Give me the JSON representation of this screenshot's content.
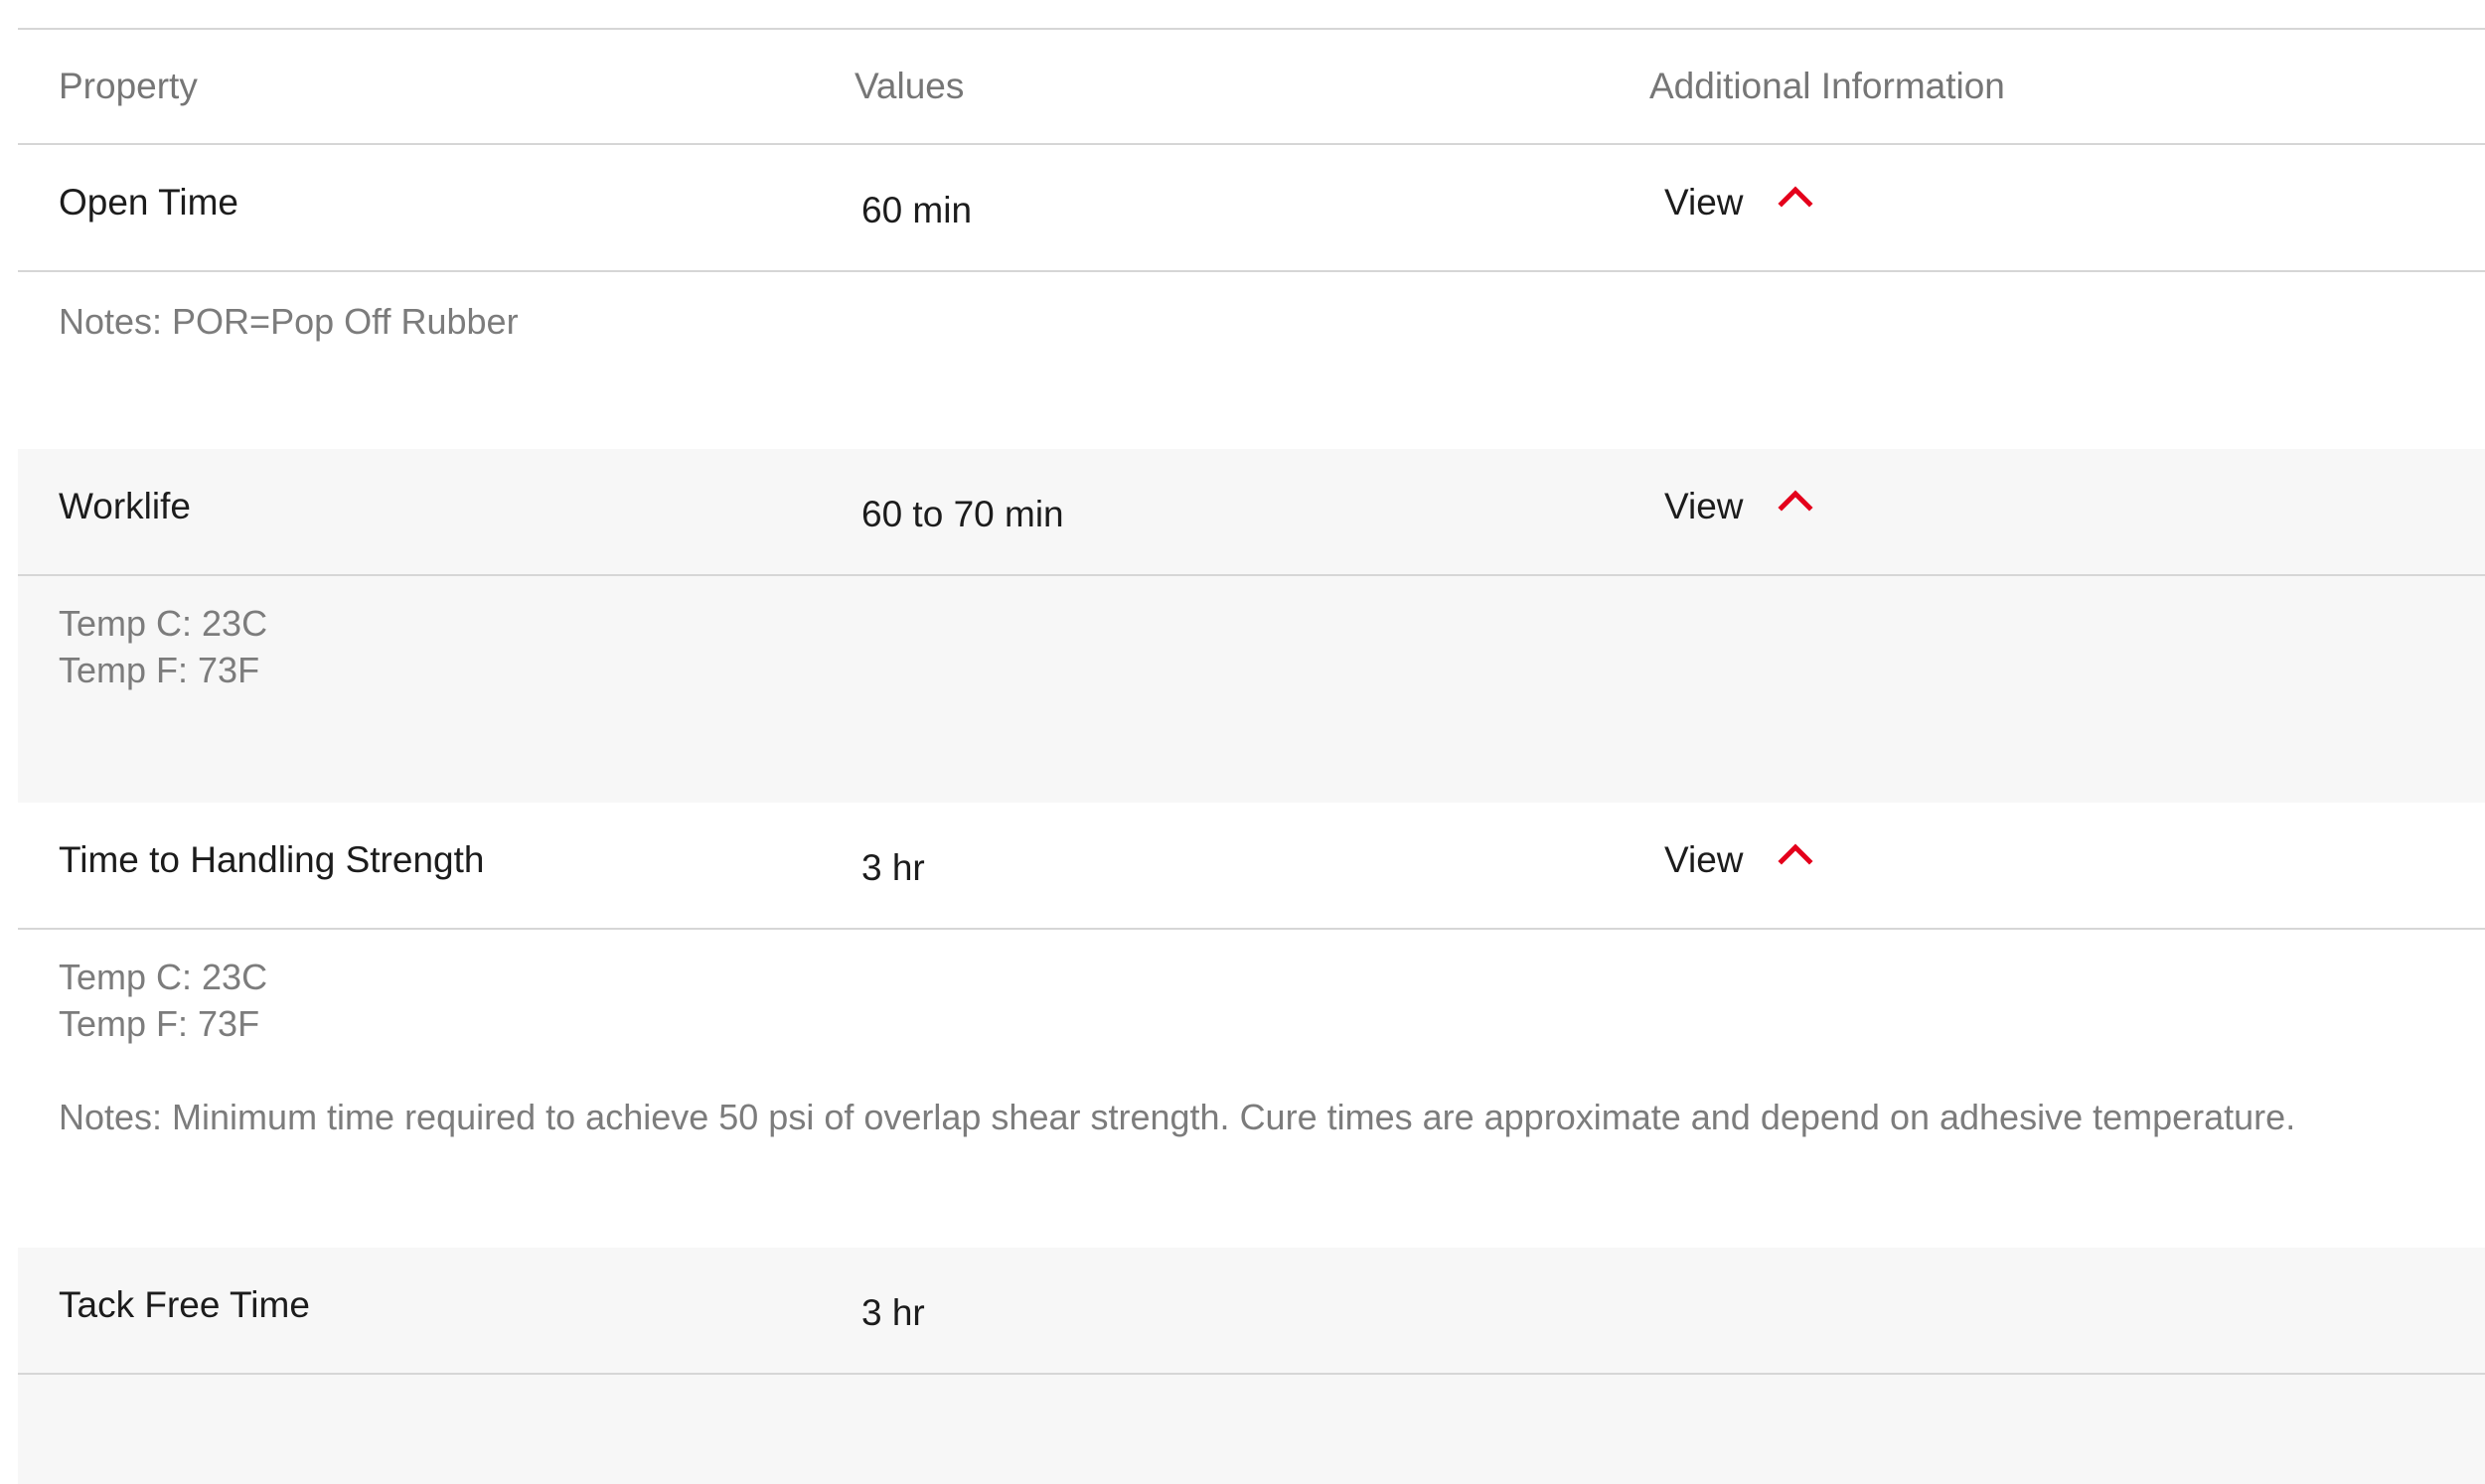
{
  "table": {
    "headers": {
      "property": "Property",
      "values": "Values",
      "additional": "Additional Information"
    },
    "rows": [
      {
        "property": "Open Time",
        "value": "60 min",
        "view_label": "View",
        "expanded_icon": "chevron-up-icon",
        "details": {
          "notes": "Notes: POR=Pop Off Rubber"
        }
      },
      {
        "property": "Worklife",
        "value": "60 to 70 min",
        "view_label": "View",
        "expanded_icon": "chevron-up-icon",
        "details": {
          "temp_c": "Temp C: 23C",
          "temp_f": "Temp F: 73F"
        }
      },
      {
        "property": "Time to Handling Strength",
        "value": "3 hr",
        "view_label": "View",
        "expanded_icon": "chevron-up-icon",
        "details": {
          "temp_c": "Temp C: 23C",
          "temp_f": "Temp F: 73F",
          "notes": "Notes: Minimum time required to achieve 50 psi of overlap shear strength. Cure times are approximate and depend on adhesive temperature."
        }
      },
      {
        "property": "Tack Free Time",
        "value": "3 hr"
      }
    ]
  },
  "colors": {
    "accent": "#e4001b",
    "row_shade": "#f7f7f7",
    "divider": "#d6d6d6"
  }
}
